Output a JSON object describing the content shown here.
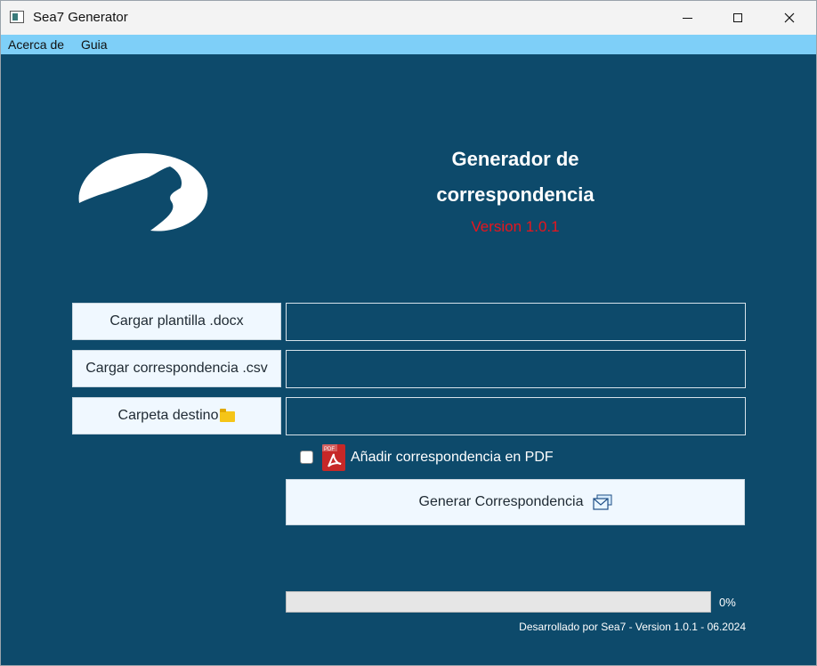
{
  "window": {
    "title": "Sea7 Generator",
    "icon": "app-window-icon"
  },
  "menu": {
    "items": [
      "Acerca de",
      "Guia"
    ]
  },
  "header": {
    "title_line1": "Generador de",
    "title_line2": "correspondencia",
    "version": "Version 1.0.1"
  },
  "inputs": {
    "template_button": "Cargar plantilla .docx",
    "template_value": "",
    "csv_button": "Cargar correspondencia .csv",
    "csv_value": "",
    "folder_button": "Carpeta destino",
    "folder_icon": "folder-icon",
    "folder_value": ""
  },
  "pdf_option": {
    "label": "Añadir correspondencia en PDF",
    "checked": false,
    "icon": "pdf-icon"
  },
  "generate": {
    "label": "Generar Correspondencia",
    "icon": "mail-icon"
  },
  "progress": {
    "value": 0,
    "label": "0%"
  },
  "footer": {
    "text": "Desarrollado por  Sea7 - Version 1.0.1 - 06.2024"
  },
  "colors": {
    "background": "#0d4a6b",
    "menubar": "#7ecff8",
    "version": "#e8151d",
    "button": "#f0f8ff"
  }
}
